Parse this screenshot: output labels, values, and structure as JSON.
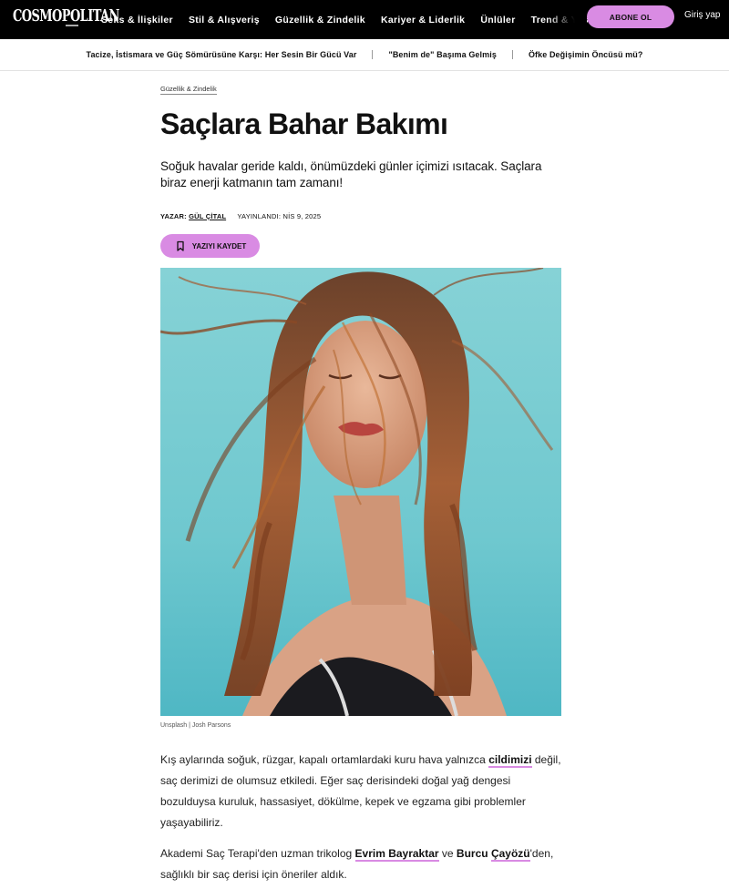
{
  "nav": {
    "logo": "COSMOPOLITAN",
    "links": [
      "Seks & İlişkiler",
      "Stil & Alışveriş",
      "Güzellik & Zindelik",
      "Kariyer & Liderlik",
      "Ünlüler",
      "Trend & Yaşam"
    ],
    "subscribe_label": "ABONE OL",
    "login_label": "Giriş yap"
  },
  "trending": [
    "Tacize, İstismara ve Güç Sömürüsüne Karşı: Her Sesin Bir Gücü Var",
    "\"Benim de\" Başıma Gelmiş",
    "Öfke Değişimin Öncüsü mü?"
  ],
  "article": {
    "breadcrumb": "Güzellik & Zindelik",
    "title": "Saçlara Bahar Bakımı",
    "dek": "Soğuk havalar geride kaldı, önümüzdeki günler içimizi ısıtacak. Saçlara biraz enerji katmanın tam zamanı!",
    "byline_prefix": "YAZAR:",
    "author": "GÜL ÇİTAL",
    "published": "YAYINLANDI: NİS 9, 2025",
    "save_label": "YAZIYI KAYDET",
    "image_caption": "Unsplash | Josh Parsons",
    "p1": {
      "t1": "Kış aylarında soğuk, rüzgar, kapalı ortamlardaki kuru hava yalnızca ",
      "link": "cildimizi",
      "t2": " değil, saç derimizi de olumsuz etkiledi. Eğer saç derisindeki doğal yağ dengesi bozulduysa kuruluk, hassasiyet, dökülme, kepek ve egzama gibi problemler yaşayabiliriz."
    },
    "p2": {
      "t1": "Akademi Saç Terapi'den uzman trikolog ",
      "link": "Evrim Bayraktar",
      "t2": " ve ",
      "name2a": "Burcu",
      "t3": " ",
      "link2": "Çayözü",
      "t4": "'den, sağlıklı bir saç derisi için öneriler aldık."
    }
  },
  "colors": {
    "accent": "#d98be3",
    "nav_bg": "#000000"
  }
}
